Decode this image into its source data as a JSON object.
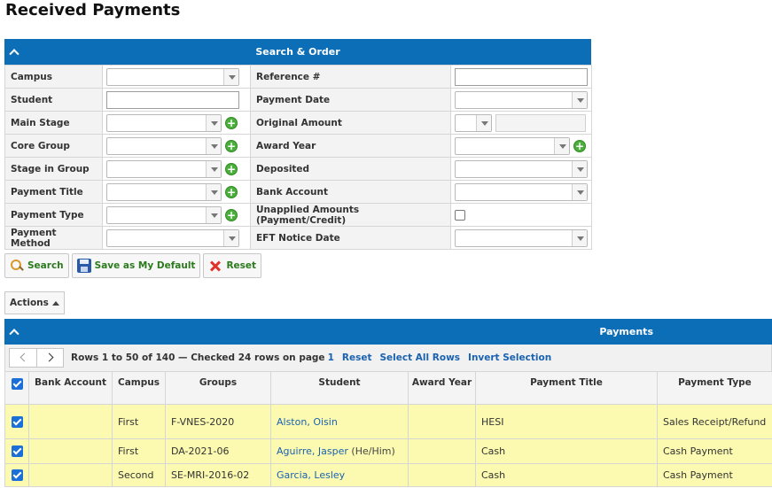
{
  "page": {
    "title": "Received Payments"
  },
  "search_panel": {
    "title": "Search & Order",
    "left_labels": [
      "Campus",
      "Student",
      "Main Stage",
      "Core Group",
      "Stage in Group",
      "Payment Title",
      "Payment Type",
      "Payment Method"
    ],
    "right_labels": [
      "Reference #",
      "Payment Date",
      "Original Amount",
      "Award Year",
      "Deposited",
      "Bank Account",
      "Unapplied Amounts (Payment/Credit)",
      "EFT Notice Date"
    ]
  },
  "buttons": {
    "search": "Search",
    "save_default": "Save as My Default",
    "reset": "Reset",
    "actions": "Actions"
  },
  "grid_panel": {
    "title": "Payments",
    "pager": {
      "rows_text": "Rows 1 to 50 of 140 — Checked 24 rows on page",
      "page": "1",
      "reset": "Reset",
      "select_all": "Select All Rows",
      "invert": "Invert Selection"
    },
    "columns": [
      "Bank Account",
      "Campus",
      "Groups",
      "Student",
      "Award Year",
      "Payment Title",
      "Payment Type"
    ],
    "rows": [
      {
        "bank_account": "",
        "campus": "First",
        "groups": "F-VNES-2020",
        "student": "Alston, Oisin",
        "pronoun": "",
        "award_year": "",
        "payment_title": "HESI",
        "payment_type": "Sales Receipt/Refund"
      },
      {
        "bank_account": "",
        "campus": "First",
        "groups": "DA-2021-06",
        "student": "Aguirre, Jasper",
        "pronoun": "(He/Him)",
        "award_year": "",
        "payment_title": "Cash",
        "payment_type": "Cash Payment"
      },
      {
        "bank_account": "",
        "campus": "Second",
        "groups": "SE-MRI-2016-02",
        "student": "Garcia, Lesley",
        "pronoun": "",
        "award_year": "",
        "payment_title": "Cash",
        "payment_type": "Cash Payment"
      }
    ]
  },
  "colors": {
    "header_blue": "#0d6eb8",
    "row_highlight": "#fbfab0",
    "link_blue": "#1a62b0",
    "add_green": "#4caf3d"
  },
  "icons": [
    "chevron-up-icon",
    "dropdown-arrow-icon",
    "add-icon",
    "magnifier-icon",
    "floppy-disk-icon",
    "red-x-icon",
    "chevron-left-icon",
    "chevron-right-icon",
    "checkbox-checked-icon"
  ]
}
